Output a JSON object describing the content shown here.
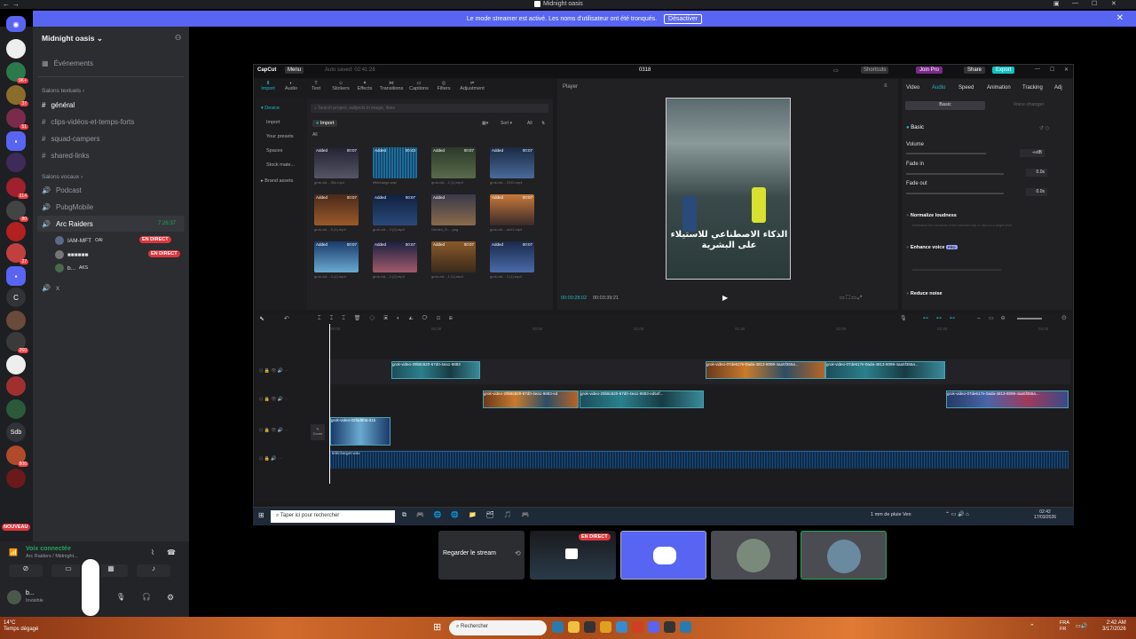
{
  "window": {
    "title": "Midnight oasis"
  },
  "banner": {
    "text": "Le mode streamer est activé. Les noms d'utilisateur ont été tronqués.",
    "button": "Désactiver"
  },
  "rail": {
    "badges": [
      "9K+",
      "37",
      "51",
      "314",
      "80",
      "27",
      "806",
      "260"
    ],
    "labels": [
      "C",
      "Sdb"
    ],
    "nouveau": "NOUVEAU"
  },
  "server": {
    "name": "Midnight oasis",
    "events": "Événements"
  },
  "text_category": "Salons textuels",
  "text_channels": [
    "général",
    "clips-vidéos-et-temps-forts",
    "squad-campers",
    "shared-links"
  ],
  "voice_category": "Salons vocaux",
  "voice_channels": [
    "Podcast",
    "PubgMobile",
    "Arc Raiders",
    "x"
  ],
  "voice_time": "7:26:37",
  "voice_users": [
    {
      "name": "IAM-MFT",
      "tag": "OAI",
      "live": "EN DIRECT"
    },
    {
      "name": "■■■■■■",
      "live": "EN DIRECT"
    },
    {
      "name": "b...",
      "tag": "AKS"
    }
  ],
  "voice_status": {
    "title": "Voix connectée",
    "sub": "Arc Raiders / Midnight..."
  },
  "user": {
    "name": "b...",
    "status": "Invisible"
  },
  "capcut": {
    "title": "0318",
    "menu": "Menu",
    "autosave": "Auto saved: 02:41:28",
    "shortcuts": "Shortcuts",
    "join_pro": "Join Pro",
    "share": "Share",
    "export": "Export",
    "toolbar": [
      "Import",
      "Audio",
      "Text",
      "Stickers",
      "Effects",
      "Transitions",
      "Captions",
      "Filters",
      "Adjustment"
    ],
    "side_items": [
      "Device",
      "Import",
      "Your presets",
      "Spaces",
      "Stock mate...",
      "Brand assets"
    ],
    "search_placeholder": "Search project, subjects in image, lines",
    "import_btn": "Import",
    "sort": "Sort",
    "all": "All",
    "media": [
      {
        "label": "Added",
        "dur": "00:07",
        "name": "grok-vid... 50c.mp4"
      },
      {
        "label": "Added",
        "dur": "00:43",
        "name": "télécharge.wav"
      },
      {
        "label": "Added",
        "dur": "00:07",
        "name": "grok-vid... 2 (1).mp4"
      },
      {
        "label": "Added",
        "dur": "00:07",
        "name": "grok-vid... 2310.mp4"
      },
      {
        "label": "Added",
        "dur": "00:07",
        "name": "grok-vid... 5 (1).mp4"
      },
      {
        "label": "Added",
        "dur": "00:07",
        "name": "grok-vid... 3 (2).mp4"
      },
      {
        "label": "Added",
        "dur": "",
        "name": "Gemini_G... .png"
      },
      {
        "label": "Added",
        "dur": "00:07",
        "name": "grok-vid... ach1.mp4"
      },
      {
        "label": "Added",
        "dur": "00:07",
        "name": "grok-vid... 3 (1).mp4"
      },
      {
        "label": "Added",
        "dur": "00:07",
        "name": "grok-vid... 3 (2).mp4"
      },
      {
        "label": "Added",
        "dur": "00:07",
        "name": "grok-vid... 1 (1).mp4"
      },
      {
        "label": "Added",
        "dur": "00:07",
        "name": "grok-vid... 3 (1).mp4"
      }
    ],
    "player": {
      "label": "Player",
      "caption": "الذكاء الاصطناعي للاستيلاء على البشرية",
      "time": "00:00:28:02",
      "total": "00:03:39:21"
    },
    "right_tabs": [
      "Video",
      "Audio",
      "Speed",
      "Animation",
      "Tracking",
      "Adj"
    ],
    "right_sub": [
      "Basic",
      "Voice changer"
    ],
    "basic": "Basic",
    "volume": {
      "label": "Volume",
      "value": "-∞dB"
    },
    "fade_in": {
      "label": "Fade in",
      "value": "0.0s"
    },
    "fade_out": {
      "label": "Fade out",
      "value": "0.0s"
    },
    "normalize": "Normalize loudness",
    "normalize_desc": "Normalize the loudness of the selected clip or clips to a target level",
    "enhance": "Enhance voice",
    "enhance_badge": "PRO",
    "reduce": "Reduce noise",
    "ruler": [
      "00:00",
      "00:30",
      "00:50",
      "01:00",
      "01:30",
      "02:00",
      "02:30",
      "03:00"
    ],
    "clips": {
      "c1": "grok-video-29b8c620-67d0-4ea1-9883",
      "c2": "grok-video-07de617e-0ada-4813-8099-4aa5f355a...",
      "c3": "grok-video-07de617e-0ada-4813-8099-4aa5f355a...",
      "c4": "grok-video-29b8c620-67d0-4ea1-9883-ed",
      "c5": "grok-video-29b8c620-67d0-4ea1-9883-ed54f...",
      "c6": "grok-video-07de617e-0ada-4813-8099-4aa5f355a...",
      "c7": "grok-video-02fad80a-d1b",
      "cover": "Cover",
      "audio": "télécharger.wav"
    }
  },
  "win_inner": {
    "search": "Taper ici pour rechercher",
    "weather": "1 mm de pluie Ven",
    "time": "02:42",
    "date": "17/03/2026"
  },
  "stream_tiles": {
    "watch": "Regarder le stream",
    "live": "EN DIRECT"
  },
  "win_outer": {
    "weather_temp": "14°C",
    "weather": "Temps dégagé",
    "search": "Rechercher",
    "lang1": "FRA",
    "lang2": "FR",
    "time": "2:42 AM",
    "date": "3/17/2026"
  },
  "colors": {
    "discord_blurple": "#5865f2",
    "live_red": "#da373c",
    "capcut_cyan": "#1fb7c5",
    "export": "#13c2c2"
  }
}
